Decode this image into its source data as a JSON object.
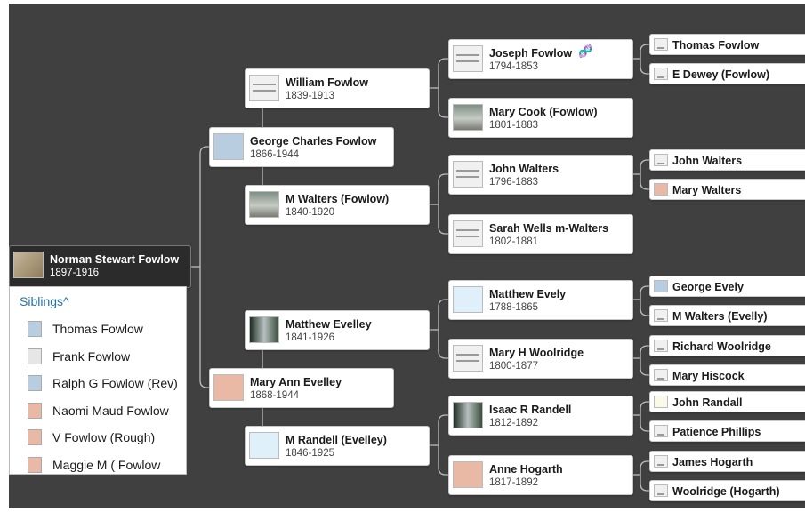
{
  "root": {
    "name": "Norman Stewart Fowlow",
    "dates": "1897-1916",
    "thumb": "photo-sepia"
  },
  "siblings": {
    "title": "Siblings^",
    "items": [
      {
        "name": "Thomas Fowlow",
        "icon": "male-silhouette-icon"
      },
      {
        "name": "Frank Fowlow",
        "icon": "document-icon"
      },
      {
        "name": "Ralph G Fowlow (Rev)",
        "icon": "male-silhouette-icon"
      },
      {
        "name": "Naomi Maud Fowlow",
        "icon": "female-silhouette-icon"
      },
      {
        "name": "V Fowlow (Rough)",
        "icon": "female-silhouette-icon"
      },
      {
        "name": "Maggie M ( Fowlow",
        "icon": "female-silhouette-icon"
      }
    ]
  },
  "parents": {
    "father": {
      "name": "George Charles Fowlow",
      "dates": "1866-1944",
      "thumb": "silhouette-m"
    },
    "mother": {
      "name": "Mary Ann Evelley",
      "dates": "1868-1944",
      "thumb": "silhouette-f"
    }
  },
  "grandparents": {
    "pf": {
      "name": "William Fowlow",
      "dates": "1839-1913",
      "thumb": "doc"
    },
    "pm": {
      "name": "M Walters (Fowlow)",
      "dates": "1840-1920",
      "thumb": "photo"
    },
    "mf": {
      "name": "Matthew Evelley",
      "dates": "1841-1926",
      "thumb": "photo-b"
    },
    "mm": {
      "name": "M Randell (Evelley)",
      "dates": "1846-1925",
      "thumb": "cross"
    }
  },
  "great_grandparents": [
    {
      "name": "Joseph Fowlow",
      "dates": "1794-1853",
      "thumb": "doc",
      "dna": true
    },
    {
      "name": "Mary Cook (Fowlow)",
      "dates": "1801-1883",
      "thumb": "photo"
    },
    {
      "name": "John Walters",
      "dates": "1796-1883",
      "thumb": "doc"
    },
    {
      "name": "Sarah Wells m-Walters",
      "dates": "1802-1881",
      "thumb": "doc"
    },
    {
      "name": "Matthew Evely",
      "dates": "1788-1865",
      "thumb": "cross"
    },
    {
      "name": "Mary H Woolridge",
      "dates": "1800-1877",
      "thumb": "doc"
    },
    {
      "name": "Isaac R Randell",
      "dates": "1812-1892",
      "thumb": "photo-b"
    },
    {
      "name": "Anne Hogarth",
      "dates": "1817-1892",
      "thumb": "silhouette-f"
    }
  ],
  "gg_grandparents": [
    {
      "name": "Thomas Fowlow",
      "thumb": "doc"
    },
    {
      "name": "E Dewey (Fowlow)",
      "thumb": "doc"
    },
    {
      "name": "John Walters",
      "thumb": "doc"
    },
    {
      "name": "Mary Walters",
      "thumb": "silhouette-f"
    },
    {
      "name": "George Evely",
      "thumb": "silhouette-m"
    },
    {
      "name": "M Walters (Evelly)",
      "thumb": "doc"
    },
    {
      "name": "Richard Woolridge",
      "thumb": "doc"
    },
    {
      "name": "Mary Hiscock",
      "thumb": "doc"
    },
    {
      "name": "John Randall",
      "thumb": "paper"
    },
    {
      "name": "Patience Phillips",
      "thumb": "doc"
    },
    {
      "name": "James Hogarth",
      "thumb": "doc"
    },
    {
      "name": "Woolridge (Hogarth)",
      "thumb": "doc"
    }
  ],
  "colors": {
    "canvas": "#404040",
    "link": "#2672a8",
    "root_card": "#2b2b2b",
    "line": "#bdbdbd"
  }
}
